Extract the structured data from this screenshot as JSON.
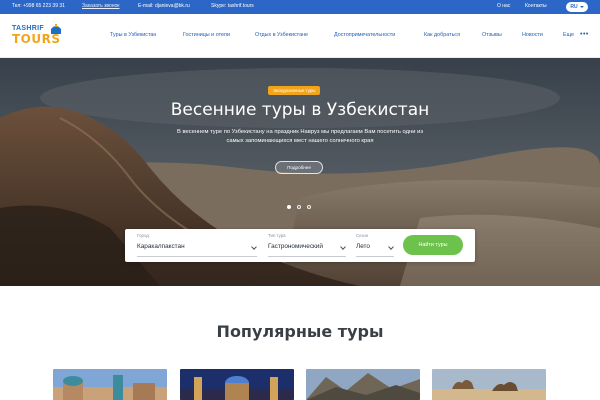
{
  "topbar": {
    "phone": "Тел: +998 65 223 39 31",
    "call": "Заказать звонок",
    "email": "E-mail: djanieva@bk.ru",
    "skype": "Skype: tashrif.tours",
    "about": "О нас",
    "contacts": "Контакты",
    "lang": "RU"
  },
  "logo": {
    "line1": "TASHRIF",
    "line2": "TOURS"
  },
  "nav": {
    "items": [
      "Туры в Узбекистан",
      "Гостиницы и отели",
      "Отдых в Узбекистане",
      "Достопримечательности",
      "Как добраться",
      "Отзывы",
      "Новости",
      "Еще"
    ],
    "more_icon": "ellipsis-icon"
  },
  "hero": {
    "badge": "Экскурсионные туры",
    "title": "Весенние туры в Узбекистан",
    "text": "В весеннем туре по Узбекистану на праздник Навруз мы предлагаем Вам посетить одни из самых запоминающихся мест нашего солнечного края",
    "button": "Подробнее",
    "slides": 3,
    "active_slide": 1
  },
  "search": {
    "city_label": "Город",
    "city_value": "Каракалпакстан",
    "type_label": "Тип тура",
    "type_value": "Гастрономический",
    "season_label": "Сезон",
    "season_value": "Лето",
    "button": "Найти туры"
  },
  "popular": {
    "title": "Популярные туры"
  },
  "colors": {
    "brand": "#2c67c7",
    "accent": "#f2a51a",
    "cta": "#6cc24a"
  }
}
